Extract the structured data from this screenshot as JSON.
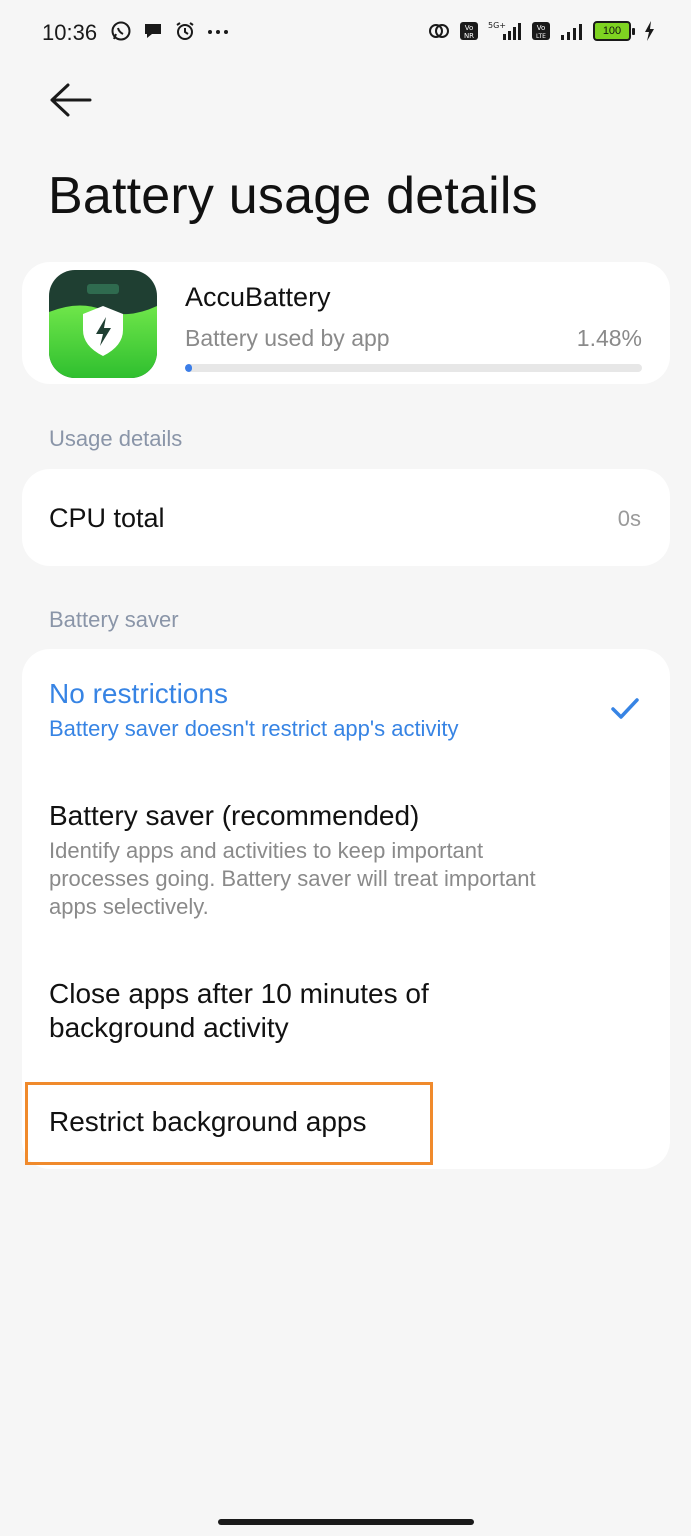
{
  "status_bar": {
    "time": "10:36",
    "battery_level": "100",
    "network_label": "5G+",
    "volte1": "Vo NR",
    "volte2": "Vo LTE"
  },
  "header": {
    "title": "Battery usage details"
  },
  "app": {
    "name": "AccuBattery",
    "usage_label": "Battery used by app",
    "usage_value": "1.48%",
    "usage_fraction": 0.0148,
    "icon": "accubattery-app-icon"
  },
  "usage_details": {
    "section_label": "Usage details",
    "cpu_label": "CPU total",
    "cpu_value": "0s"
  },
  "battery_saver": {
    "section_label": "Battery saver",
    "options": [
      {
        "title": "No restrictions",
        "description": "Battery saver doesn't restrict app's activity",
        "selected": true
      },
      {
        "title": "Battery saver (recommended)",
        "description": "Identify apps and activities to keep important processes going. Battery saver will treat important apps selectively.",
        "selected": false
      },
      {
        "title": "Close apps after 10 minutes of background activity",
        "description": "",
        "selected": false
      },
      {
        "title": "Restrict background apps",
        "description": "",
        "selected": false
      }
    ]
  },
  "colors": {
    "accent": "#3784e4",
    "highlight_border": "#f08a2c",
    "background": "#f6f6f6",
    "card": "#ffffff"
  }
}
